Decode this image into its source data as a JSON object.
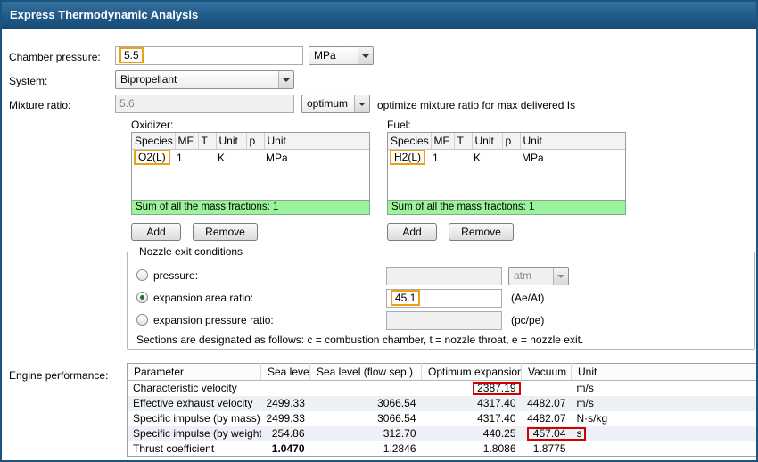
{
  "window": {
    "title": "Express Thermodynamic Analysis"
  },
  "form": {
    "chamber_pressure_label": "Chamber pressure:",
    "chamber_pressure_value": "5.5",
    "chamber_pressure_unit": "MPa",
    "system_label": "System:",
    "system_value": "Bipropellant",
    "mixture_ratio_label": "Mixture ratio:",
    "mixture_ratio_value": "5.6",
    "mixture_ratio_mode": "optimum",
    "mixture_ratio_hint": "optimize mixture ratio for max delivered Is"
  },
  "oxidizer": {
    "label": "Oxidizer:",
    "columns": [
      "Species",
      "MF",
      "T",
      "Unit",
      "p",
      "Unit"
    ],
    "row": {
      "species": "O2(L)",
      "mf": "1",
      "t": "",
      "t_unit": "K",
      "p": "",
      "p_unit": "MPa"
    },
    "sum_text": "Sum of all the mass fractions: 1",
    "add": "Add",
    "remove": "Remove"
  },
  "fuel": {
    "label": "Fuel:",
    "columns": [
      "Species",
      "MF",
      "T",
      "Unit",
      "p",
      "Unit"
    ],
    "row": {
      "species": "H2(L)",
      "mf": "1",
      "t": "",
      "t_unit": "K",
      "p": "",
      "p_unit": "MPa"
    },
    "sum_text": "Sum of all the mass fractions: 1",
    "add": "Add",
    "remove": "Remove"
  },
  "nozzle": {
    "title": "Nozzle exit conditions",
    "pressure_label": "pressure:",
    "pressure_value": "",
    "pressure_unit": "atm",
    "area_ratio_label": "expansion area ratio:",
    "area_ratio_value": "45.1",
    "area_ratio_suffix": "(Ae/At)",
    "pressure_ratio_label": "expansion pressure ratio:",
    "pressure_ratio_value": "",
    "pressure_ratio_suffix": "(pc/pe)",
    "note": "Sections are designated as follows: c = combustion chamber, t = nozzle throat, e = nozzle exit."
  },
  "engine": {
    "label": "Engine performance:",
    "columns": [
      "Parameter",
      "Sea level",
      "Sea level (flow sep.)",
      "Optimum expansion",
      "Vacuum",
      "Unit"
    ],
    "rows": [
      {
        "parameter": "Characteristic velocity",
        "sea_level": "",
        "flow_sep": "",
        "optimum": "2387.19",
        "vacuum": "",
        "unit": "m/s"
      },
      {
        "parameter": "Effective exhaust velocity",
        "sea_level": "2499.33",
        "flow_sep": "3066.54",
        "optimum": "4317.40",
        "vacuum": "4482.07",
        "unit": "m/s"
      },
      {
        "parameter": "Specific impulse (by mass)",
        "sea_level": "2499.33",
        "flow_sep": "3066.54",
        "optimum": "4317.40",
        "vacuum": "4482.07",
        "unit": "N·s/kg"
      },
      {
        "parameter": "Specific impulse (by weight)",
        "sea_level": "254.86",
        "flow_sep": "312.70",
        "optimum": "440.25",
        "vacuum": "457.04",
        "unit": "s"
      },
      {
        "parameter": "Thrust coefficient",
        "sea_level": "1.0470",
        "flow_sep": "1.2846",
        "optimum": "1.8086",
        "vacuum": "1.8775",
        "unit": ""
      }
    ]
  },
  "annotations": {
    "highlight_color": "#eda112",
    "callout_color": "#d40000"
  }
}
